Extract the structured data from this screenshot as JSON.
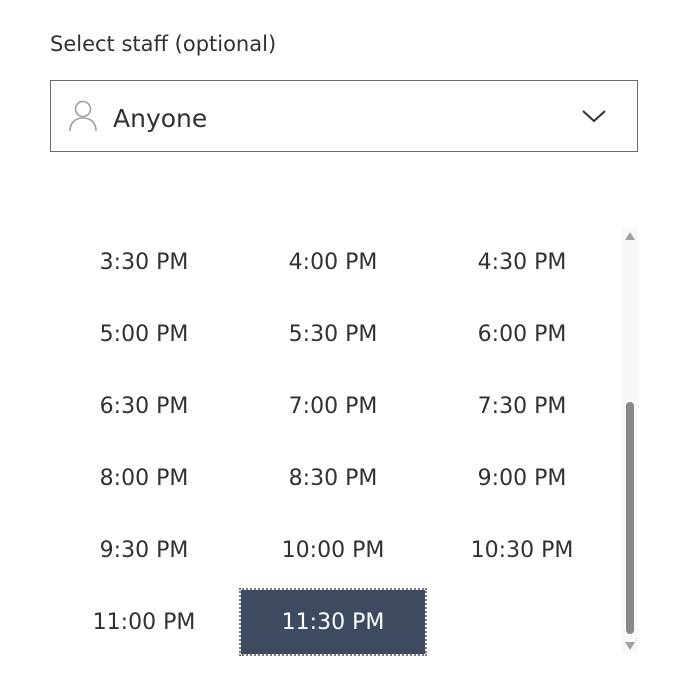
{
  "staff": {
    "label": "Select staff (optional)",
    "selected_value": "Anyone",
    "icons": {
      "person": "person-icon",
      "dropdown": "chevron-down-icon"
    }
  },
  "time_slots": [
    {
      "label": "3:30 PM",
      "selected": false
    },
    {
      "label": "4:00 PM",
      "selected": false
    },
    {
      "label": "4:30 PM",
      "selected": false
    },
    {
      "label": "5:00 PM",
      "selected": false
    },
    {
      "label": "5:30 PM",
      "selected": false
    },
    {
      "label": "6:00 PM",
      "selected": false
    },
    {
      "label": "6:30 PM",
      "selected": false
    },
    {
      "label": "7:00 PM",
      "selected": false
    },
    {
      "label": "7:30 PM",
      "selected": false
    },
    {
      "label": "8:00 PM",
      "selected": false
    },
    {
      "label": "8:30 PM",
      "selected": false
    },
    {
      "label": "9:00 PM",
      "selected": false
    },
    {
      "label": "9:30 PM",
      "selected": false
    },
    {
      "label": "10:00 PM",
      "selected": false
    },
    {
      "label": "10:30 PM",
      "selected": false
    },
    {
      "label": "11:00 PM",
      "selected": false
    },
    {
      "label": "11:30 PM",
      "selected": true
    }
  ],
  "colors": {
    "selected_background": "#3d4a5f",
    "selected_text": "#ffffff",
    "text": "#323130"
  }
}
